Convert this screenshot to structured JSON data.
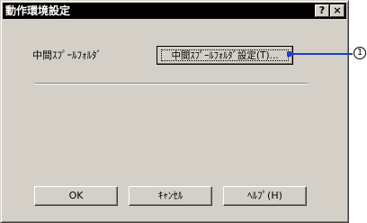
{
  "window": {
    "title": "動作環境設定",
    "help_button": "?",
    "close_button": "×"
  },
  "main": {
    "field_label": "中間ｽﾌﾟｰﾙﾌｫﾙﾀﾞ",
    "spool_button_label": "中間ｽﾌﾟｰﾙﾌｫﾙﾀﾞ設定(T)..."
  },
  "footer": {
    "ok_label": "OK",
    "cancel_label": "ｷｬﾝｾﾙ",
    "help_label": "ﾍﾙﾌﾟ(H)"
  },
  "annotation": {
    "callout_number": "1",
    "callout_color": "#1a3fd0"
  }
}
